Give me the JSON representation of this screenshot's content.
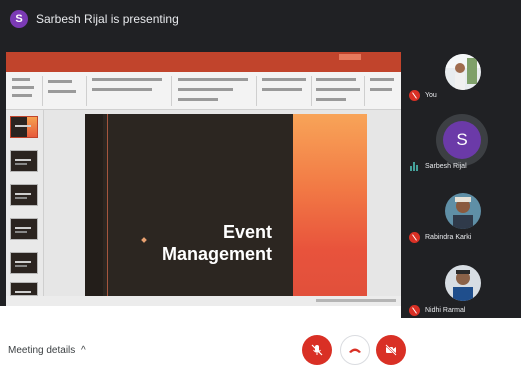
{
  "topbar": {
    "presenter_initial": "S",
    "presenting_text": "Sarbesh Rijal is presenting"
  },
  "shared_screen": {
    "app": "PowerPoint",
    "slide": {
      "title_line1": "Event",
      "title_line2": "Management"
    }
  },
  "participants": [
    {
      "name": "You",
      "muted": true
    },
    {
      "name": "Sarbesh Rijal",
      "initial": "S",
      "speaking": true
    },
    {
      "name": "Rabindra Karki",
      "muted": true
    },
    {
      "name": "Nidhi Rarmal",
      "muted": true
    }
  ],
  "bottombar": {
    "meeting_details_label": "Meeting details",
    "chevron": "^"
  },
  "colors": {
    "accent_red": "#d93025",
    "avatar_purple": "#7b3ab5",
    "ppt_orange": "#c1442c"
  },
  "icons": {
    "mic": "mic-off-icon",
    "end_call": "call-end-icon",
    "camera": "video-off-icon"
  }
}
